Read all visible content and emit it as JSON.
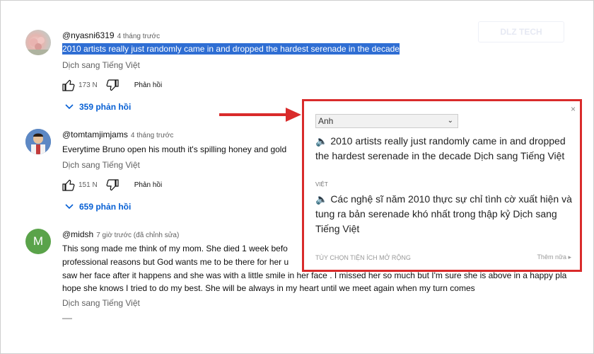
{
  "watermark": "DLZ TECH",
  "comments": [
    {
      "user": "@nyasni6319",
      "time": "4 tháng trước",
      "text": "2010 artists really just randomly came in and dropped the hardest serenade in the decade",
      "translate": "Dịch sang Tiếng Việt",
      "likes": "173 N",
      "reply": "Phản hồi",
      "replies": "359 phản hồi"
    },
    {
      "user": "@tomtamjimjams",
      "time": "4 tháng trước",
      "text": "Everytime Bruno open his mouth it's spilling honey and gold",
      "translate": "Dịch sang Tiếng Việt",
      "likes": "151 N",
      "reply": "Phản hồi",
      "replies": "659 phản hồi"
    },
    {
      "user": "@midsh",
      "time": "7 giờ trước (đã chỉnh sửa)",
      "avatar_letter": "M",
      "lines": [
        "This song made me think of my mom. She died 1 week befo",
        "professional reasons but God wants me to be there for her u",
        "saw her face after it happens and she was with a little smile in her face . I missed her so much but I'm sure she is above in a happy pla",
        "hope she knows I tried to do my best. She will be always in my heart until we meet again when my turn comes"
      ],
      "translate": "Dịch sang Tiếng Việt"
    }
  ],
  "popup": {
    "language": "Anh",
    "source_text": "🔈 2010 artists really just randomly came in and dropped the hardest serenade in the decade Dịch sang Tiếng Việt",
    "target_label": "VIỆT",
    "target_text": "🔈 Các nghệ sĩ năm 2010 thực sự chỉ tình cờ xuất hiện và tung ra bản serenade khó nhất trong thập kỷ Dịch sang Tiếng Việt",
    "options_label": "TÙY CHỌN TIỆN ÍCH MỞ RỘNG",
    "more_label": "Thêm nữa ▸",
    "close": "×"
  },
  "colors": {
    "accent": "#065fd4",
    "highlight": "#d92b2b",
    "selection": "#2f6ed3",
    "avatar_m": "#5aa34a"
  }
}
